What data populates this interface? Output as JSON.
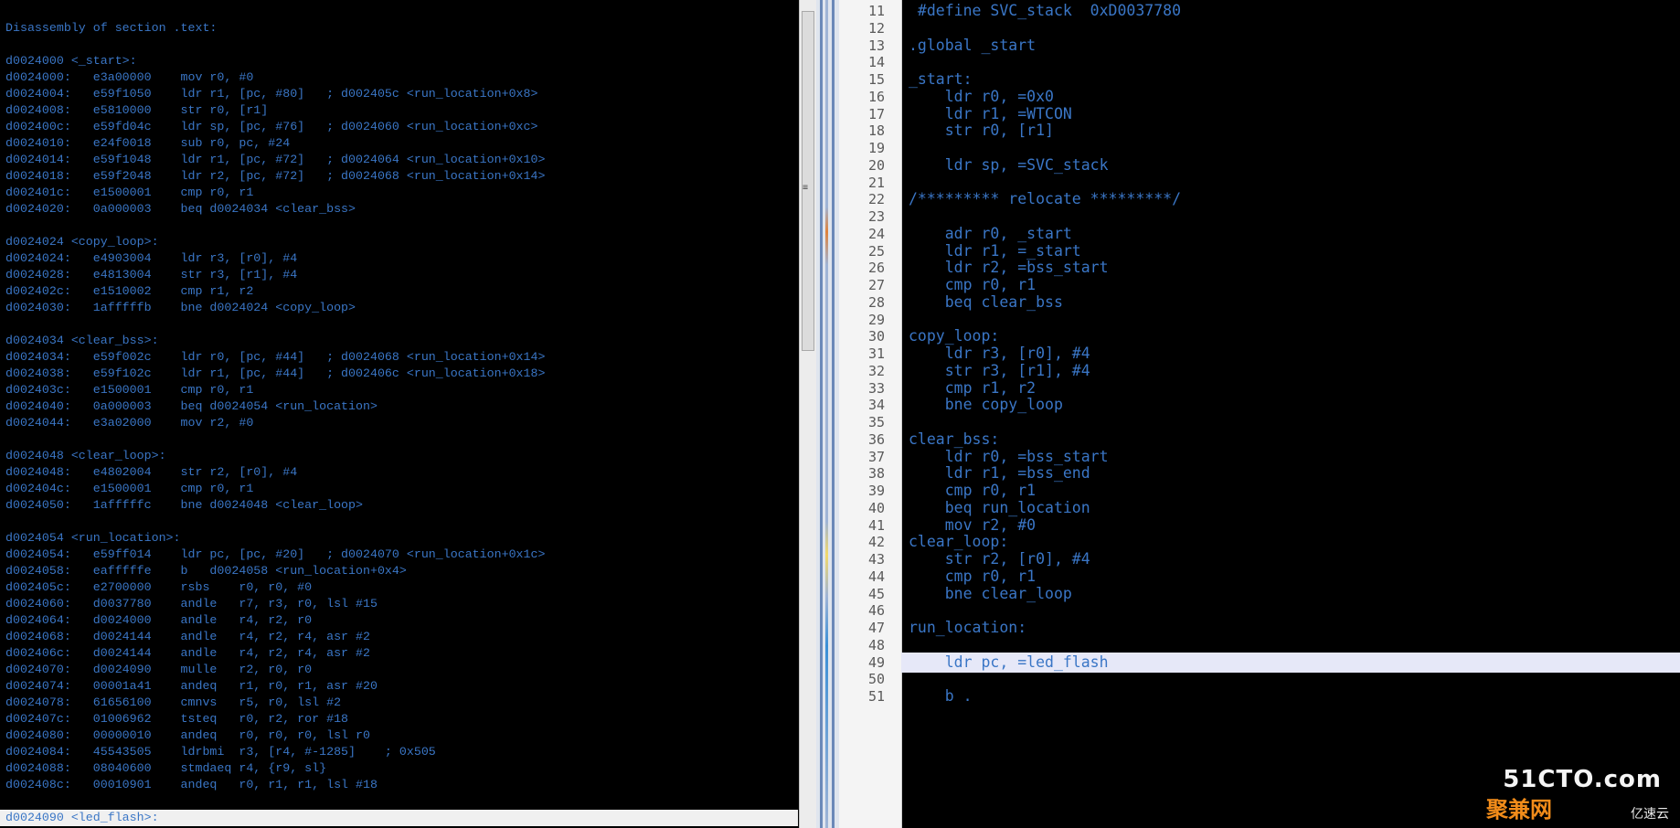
{
  "disassembly": {
    "lines": [
      "Disassembly of section .text:",
      "",
      "d0024000 <_start>:",
      "d0024000:   e3a00000    mov r0, #0",
      "d0024004:   e59f1050    ldr r1, [pc, #80]   ; d002405c <run_location+0x8>",
      "d0024008:   e5810000    str r0, [r1]",
      "d002400c:   e59fd04c    ldr sp, [pc, #76]   ; d0024060 <run_location+0xc>",
      "d0024010:   e24f0018    sub r0, pc, #24",
      "d0024014:   e59f1048    ldr r1, [pc, #72]   ; d0024064 <run_location+0x10>",
      "d0024018:   e59f2048    ldr r2, [pc, #72]   ; d0024068 <run_location+0x14>",
      "d002401c:   e1500001    cmp r0, r1",
      "d0024020:   0a000003    beq d0024034 <clear_bss>",
      "",
      "d0024024 <copy_loop>:",
      "d0024024:   e4903004    ldr r3, [r0], #4",
      "d0024028:   e4813004    str r3, [r1], #4",
      "d002402c:   e1510002    cmp r1, r2",
      "d0024030:   1afffffb    bne d0024024 <copy_loop>",
      "",
      "d0024034 <clear_bss>:",
      "d0024034:   e59f002c    ldr r0, [pc, #44]   ; d0024068 <run_location+0x14>",
      "d0024038:   e59f102c    ldr r1, [pc, #44]   ; d002406c <run_location+0x18>",
      "d002403c:   e1500001    cmp r0, r1",
      "d0024040:   0a000003    beq d0024054 <run_location>",
      "d0024044:   e3a02000    mov r2, #0",
      "",
      "d0024048 <clear_loop>:",
      "d0024048:   e4802004    str r2, [r0], #4",
      "d002404c:   e1500001    cmp r0, r1",
      "d0024050:   1afffffc    bne d0024048 <clear_loop>",
      "",
      "d0024054 <run_location>:",
      "d0024054:   e59ff014    ldr pc, [pc, #20]   ; d0024070 <run_location+0x1c>",
      "d0024058:   eafffffe    b   d0024058 <run_location+0x4>",
      "d002405c:   e2700000    rsbs    r0, r0, #0",
      "d0024060:   d0037780    andle   r7, r3, r0, lsl #15",
      "d0024064:   d0024000    andle   r4, r2, r0",
      "d0024068:   d0024144    andle   r4, r2, r4, asr #2",
      "d002406c:   d0024144    andle   r4, r2, r4, asr #2",
      "d0024070:   d0024090    mulle   r2, r0, r0",
      "d0024074:   00001a41    andeq   r1, r0, r1, asr #20",
      "d0024078:   61656100    cmnvs   r5, r0, lsl #2",
      "d002407c:   01006962    tsteq   r0, r2, ror #18",
      "d0024080:   00000010    andeq   r0, r0, r0, lsl r0",
      "d0024084:   45543505    ldrbmi  r3, [r4, #-1285]    ; 0x505",
      "d0024088:   08040600    stmdaeq r4, {r9, sl}",
      "d002408c:   00010901    andeq   r0, r1, r1, lsl #18",
      "",
      "d0024090 <led_flash>:"
    ],
    "highlighted_index": 48
  },
  "scrollbar": {
    "grip": "≡"
  },
  "source": {
    "first_line_number": 11,
    "highlighted_line_number": 49,
    "lines": [
      " #define SVC_stack  0xD0037780",
      "",
      ".global _start",
      "",
      "_start:",
      "    ldr r0, =0x0",
      "    ldr r1, =WTCON",
      "    str r0, [r1]",
      "",
      "    ldr sp, =SVC_stack",
      "",
      "/********* relocate *********/",
      "",
      "    adr r0, _start",
      "    ldr r1, =_start",
      "    ldr r2, =bss_start",
      "    cmp r0, r1",
      "    beq clear_bss",
      "",
      "copy_loop:",
      "    ldr r3, [r0], #4",
      "    str r3, [r1], #4",
      "    cmp r1, r2",
      "    bne copy_loop",
      "",
      "clear_bss:",
      "    ldr r0, =bss_start",
      "    ldr r1, =bss_end",
      "    cmp r0, r1",
      "    beq run_location",
      "    mov r2, #0",
      "clear_loop:",
      "    str r2, [r0], #4",
      "    cmp r0, r1",
      "    bne clear_loop",
      "",
      "run_location:",
      "",
      "    ldr pc, =led_flash",
      "",
      "    b ."
    ]
  },
  "watermark": {
    "site": "51CTO.com",
    "cn": "聚兼网",
    "brand": "亿速云"
  }
}
